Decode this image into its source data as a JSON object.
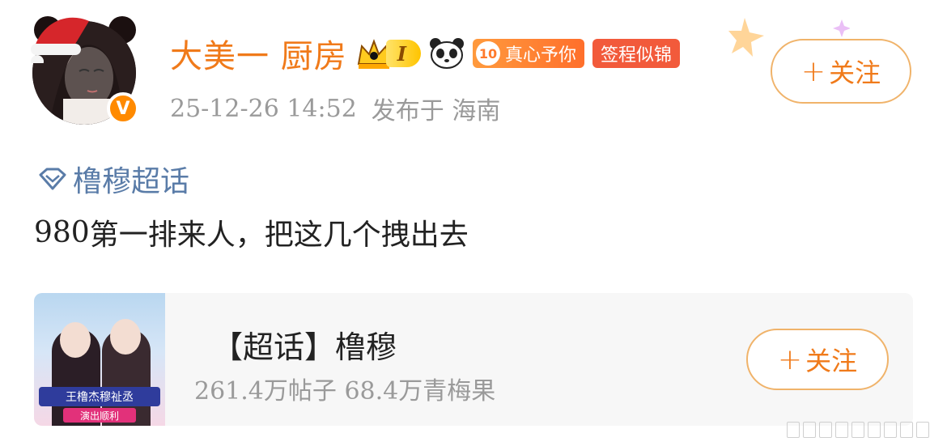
{
  "post": {
    "author": {
      "name": "大美一 厨房",
      "verified_badge": "V",
      "level_badge": "I",
      "heart_badge": {
        "number": "10",
        "label": "真心予你"
      },
      "tag_badge": "签程似锦"
    },
    "follow_label": "关注",
    "timestamp": "25-12-26 14:52",
    "location": "发布于 海南",
    "topic": "橹穆超话",
    "text_number": "980",
    "text": "第一排来人，把这几个拽出去"
  },
  "supertopic_card": {
    "title": "【超话】橹穆",
    "posts_count": "261.4",
    "posts_label": "万帖子",
    "fans_count": "68.4",
    "fans_label": "万青梅果",
    "follow_label": "关注",
    "thumbnail_banner": "王橹杰穆祉丞",
    "thumbnail_sub": "演出顺利"
  },
  "colors": {
    "accent_orange": "#f07a1a",
    "topic_blue": "#5a7ca8",
    "meta_gray": "#9a9a9a"
  },
  "icons": [
    "avatar",
    "verified-icon",
    "crown-icon",
    "panda-icon",
    "supertopic-diamond-icon",
    "plus-icon"
  ]
}
